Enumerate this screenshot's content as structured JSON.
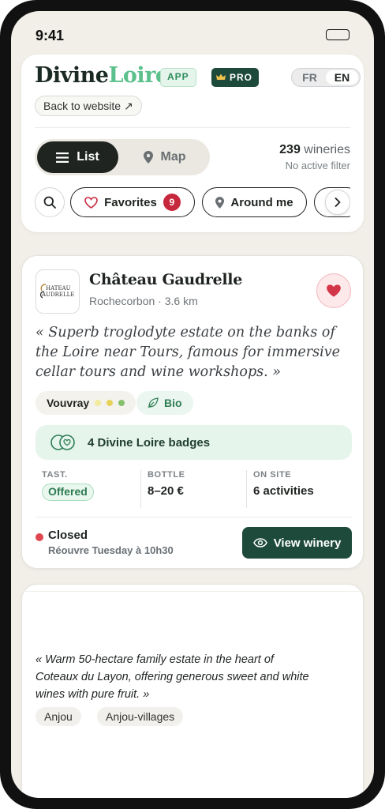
{
  "status_bar": {
    "time": "9:41"
  },
  "header": {
    "logo_part1": "Divine",
    "logo_part2": "Loire",
    "badge_app": "APP",
    "badge_pro": "PRO",
    "lang_fr": "FR",
    "lang_en": "EN",
    "back_link": "Back to website ↗"
  },
  "view_toggle": {
    "list_label": "List",
    "map_label": "Map"
  },
  "results": {
    "count": "239",
    "count_label": " wineries",
    "filter_status": "No active filter"
  },
  "chips": {
    "favorites_label": "Favorites",
    "favorites_count": "9",
    "around_label": "Around me"
  },
  "winery": {
    "logo_text": "CHATEAU GAUDRELLE",
    "name": "Château Gaudrelle",
    "location": "Rochecorbon · 3.6 km",
    "quote": "« Superb troglodyte estate on the banks of the Loire near Tours, famous for immersive cellar tours and wine workshops. »",
    "appellation": "Vouvray",
    "bio_label": "Bio",
    "badges_label": "4 Divine Loire badges",
    "stats": [
      {
        "label": "TAST.",
        "value": "Offered"
      },
      {
        "label": "BOTTLE",
        "value": "8–20 €"
      },
      {
        "label": "ON SITE",
        "value": "6 activities"
      }
    ],
    "status": "Closed",
    "reopen": "Réouvre Tuesday à 10h30",
    "view_button": "View winery"
  },
  "winery2": {
    "quote": "« Warm 50-hectare family estate in the heart of Coteaux du Layon, offering generous sweet and white wines with pure fruit. »",
    "tags": [
      "Anjou",
      "Anjou-villages"
    ]
  },
  "colors": {
    "brand_dark": "#1d4a3a",
    "brand_green": "#5cc08c",
    "heart_red": "#c8283d",
    "closed_red": "#e0464f"
  }
}
